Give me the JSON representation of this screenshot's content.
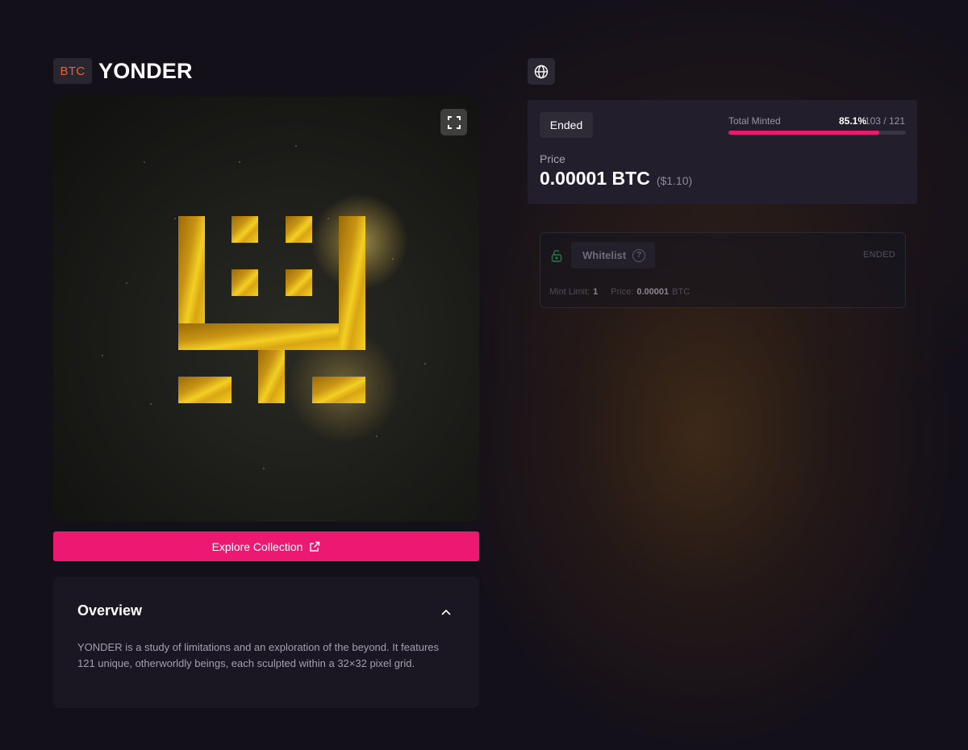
{
  "header": {
    "chain_badge": "BTC",
    "title": "YONDER"
  },
  "artwork": {
    "description_icon": "fullscreen-icon"
  },
  "explore": {
    "label": "Explore Collection"
  },
  "overview": {
    "title": "Overview",
    "text": "YONDER is a study of limitations and an exploration of the beyond. It features 121 unique, otherworldly beings, each sculpted within a 32×32 pixel grid."
  },
  "mint": {
    "status": "Ended",
    "minted_label": "Total Minted",
    "minted_pct": "85.1%",
    "minted_count": "103 / 121",
    "progress_fraction": 0.851,
    "price_label": "Price",
    "price_value": "0.00001 BTC",
    "price_usd": "($1.10)"
  },
  "phase": {
    "name": "Whitelist",
    "status": "ENDED",
    "mint_limit_label": "Mint Limit:",
    "mint_limit_value": "1",
    "price_label": "Price:",
    "price_value": "0.00001",
    "price_unit": "BTC"
  },
  "colors": {
    "accent": "#ec1871",
    "btc": "#e8612f",
    "gold": "#f2c418"
  }
}
